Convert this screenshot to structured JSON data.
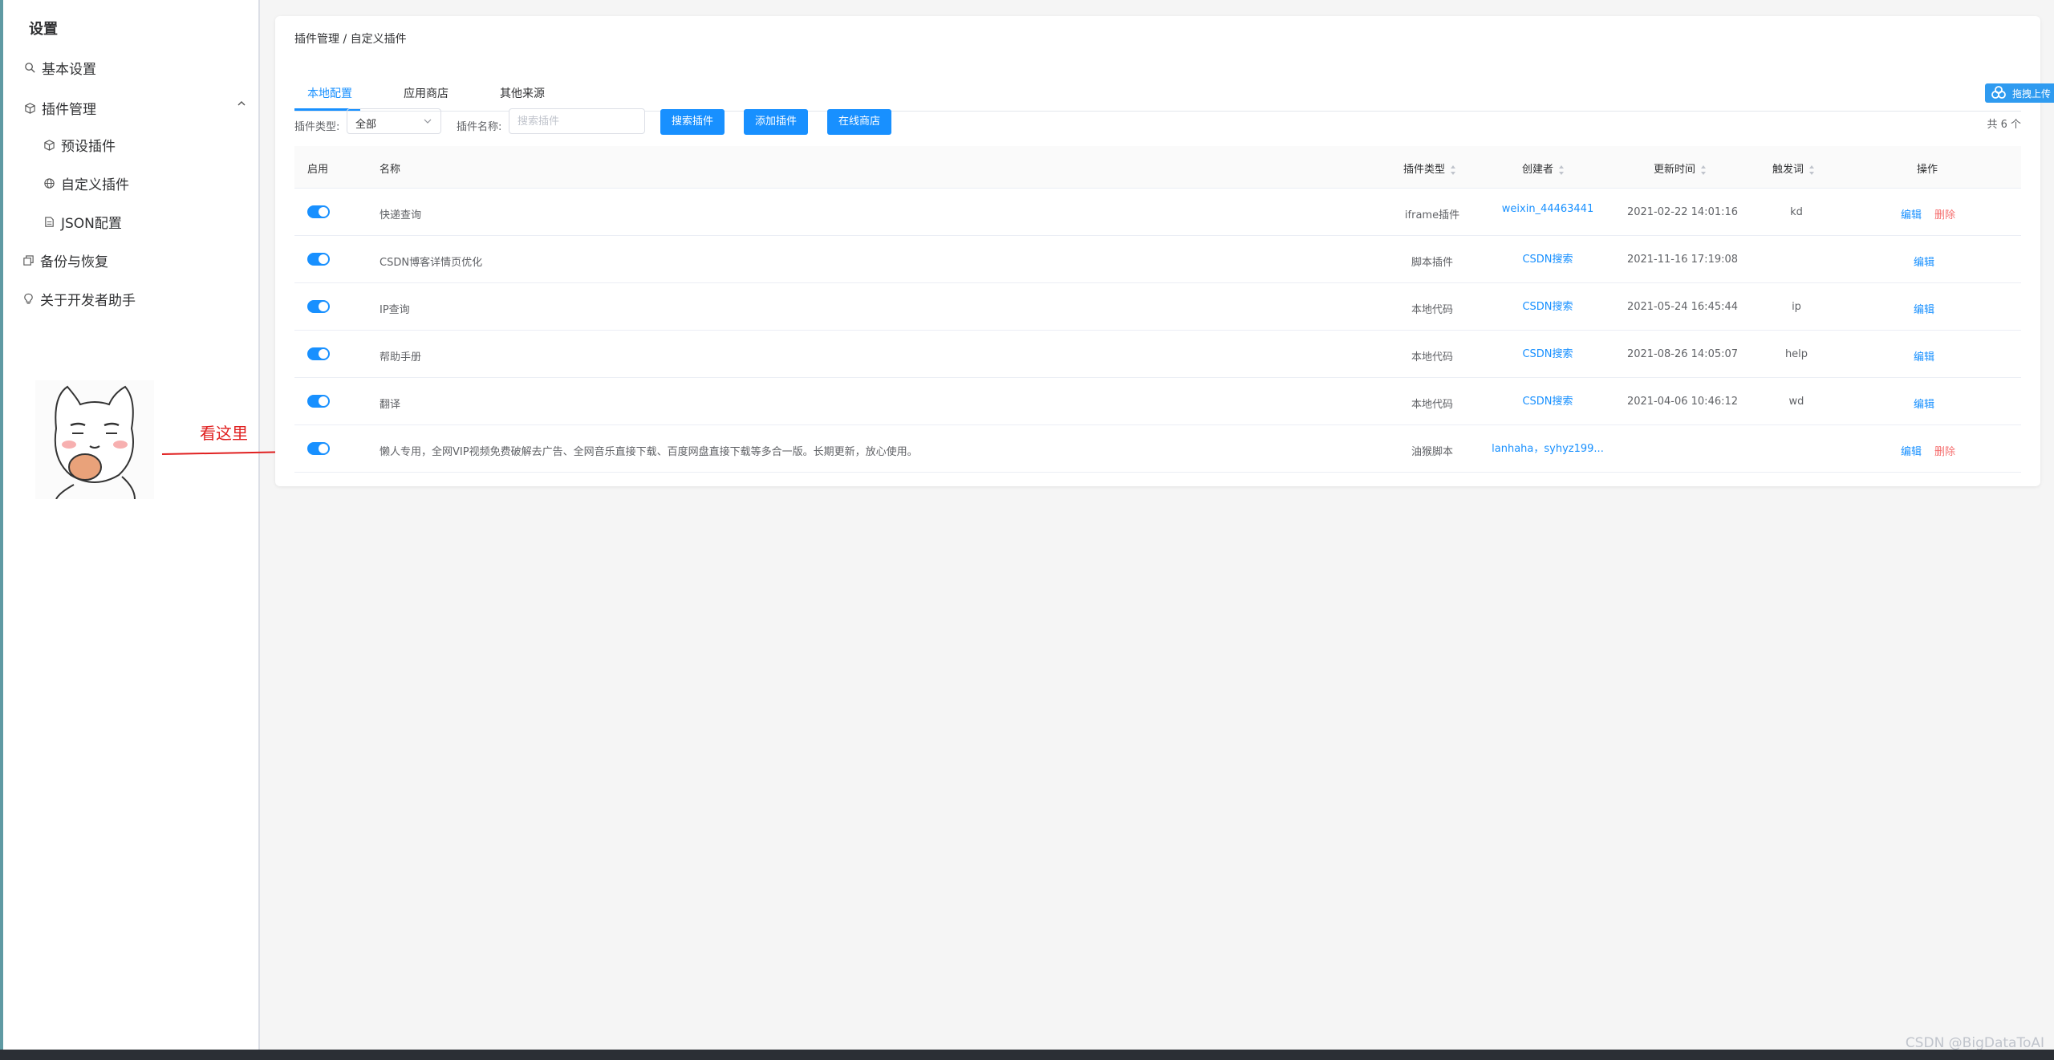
{
  "sidebar": {
    "title": "设置",
    "items": [
      {
        "label": "基本设置",
        "icon": "search-icon"
      },
      {
        "label": "插件管理",
        "icon": "box-icon"
      },
      {
        "label": "预设插件",
        "icon": "box-icon"
      },
      {
        "label": "自定义插件",
        "icon": "globe-icon"
      },
      {
        "label": "JSON配置",
        "icon": "file-icon"
      },
      {
        "label": "备份与恢复",
        "icon": "copy-icon"
      },
      {
        "label": "关于开发者助手",
        "icon": "bulb-icon"
      }
    ]
  },
  "annotation": {
    "label": "看这里",
    "color": "#e02020"
  },
  "main": {
    "breadcrumb": "插件管理 / 自定义插件",
    "tabs": [
      "本地配置",
      "应用商店",
      "其他来源"
    ],
    "filter": {
      "type_label": "插件类型:",
      "type_value": "全部",
      "name_label": "插件名称:",
      "name_placeholder": "搜索插件",
      "search_btn": "搜索插件",
      "add_btn": "添加插件",
      "store_btn": "在线商店",
      "total": "共 6 个"
    },
    "float_badge": "拖拽上传",
    "table": {
      "headers": [
        "启用",
        "名称",
        "插件类型",
        "创建者",
        "更新时间",
        "触发词",
        "操作"
      ],
      "rows": [
        {
          "enabled": true,
          "name": "快递查询",
          "type": "iframe插件",
          "creator": "weixin_44463441",
          "updated": "2021-02-22 14:01:16",
          "trigger": "kd",
          "ops": [
            "编辑",
            "删除"
          ]
        },
        {
          "enabled": true,
          "name": "CSDN博客详情页优化",
          "type": "脚本插件",
          "creator": "CSDN搜索",
          "updated": "2021-11-16 17:19:08",
          "trigger": "",
          "ops": [
            "编辑"
          ]
        },
        {
          "enabled": true,
          "name": "IP查询",
          "type": "本地代码",
          "creator": "CSDN搜索",
          "updated": "2021-05-24 16:45:44",
          "trigger": "ip",
          "ops": [
            "编辑"
          ]
        },
        {
          "enabled": true,
          "name": "帮助手册",
          "type": "本地代码",
          "creator": "CSDN搜索",
          "updated": "2021-08-26 14:05:07",
          "trigger": "help",
          "ops": [
            "编辑"
          ]
        },
        {
          "enabled": true,
          "name": "翻译",
          "type": "本地代码",
          "creator": "CSDN搜索",
          "updated": "2021-04-06 10:46:12",
          "trigger": "wd",
          "ops": [
            "编辑"
          ]
        },
        {
          "enabled": true,
          "name": "懒人专用，全网VIP视频免费破解去广告、全网音乐直接下载、百度网盘直接下载等多合一版。长期更新，放心使用。",
          "type": "油猴脚本",
          "creator": "lanhaha，syhyz199...",
          "updated": "",
          "trigger": "",
          "ops": [
            "编辑",
            "删除"
          ]
        }
      ]
    }
  },
  "watermark": "CSDN @BigDataToAI",
  "colors": {
    "accent": "#1890ff",
    "danger": "#f56c6c"
  }
}
